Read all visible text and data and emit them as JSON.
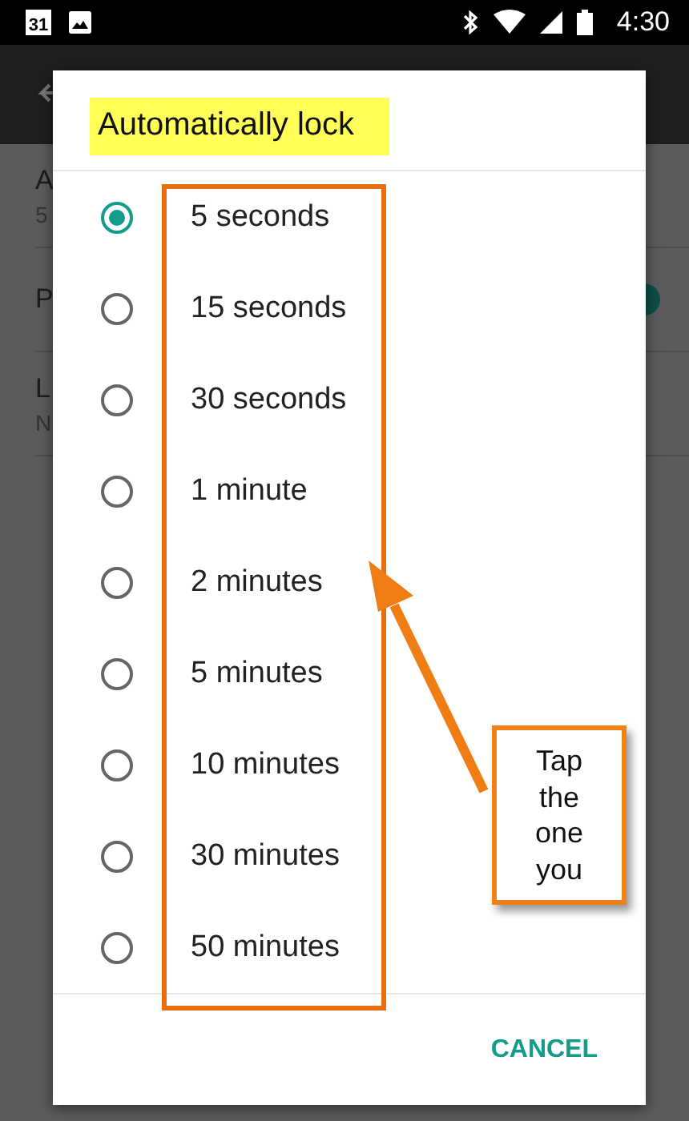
{
  "status_bar": {
    "calendar_day": "31",
    "time": "4:30"
  },
  "background_items": [
    {
      "title": "A",
      "summary": "5"
    },
    {
      "title": "P",
      "toggle": true
    },
    {
      "title": "L",
      "summary": "N"
    }
  ],
  "dialog": {
    "title": "Automatically lock",
    "options": [
      {
        "label": "5 seconds",
        "selected": true
      },
      {
        "label": "15 seconds",
        "selected": false
      },
      {
        "label": "30 seconds",
        "selected": false
      },
      {
        "label": "1 minute",
        "selected": false
      },
      {
        "label": "2 minutes",
        "selected": false
      },
      {
        "label": "5 minutes",
        "selected": false
      },
      {
        "label": "10 minutes",
        "selected": false
      },
      {
        "label": "30 minutes",
        "selected": false
      },
      {
        "label": "50 minutes",
        "selected": false
      }
    ],
    "cancel_button": "CANCEL"
  },
  "callout": {
    "text": "Tap the one you"
  }
}
